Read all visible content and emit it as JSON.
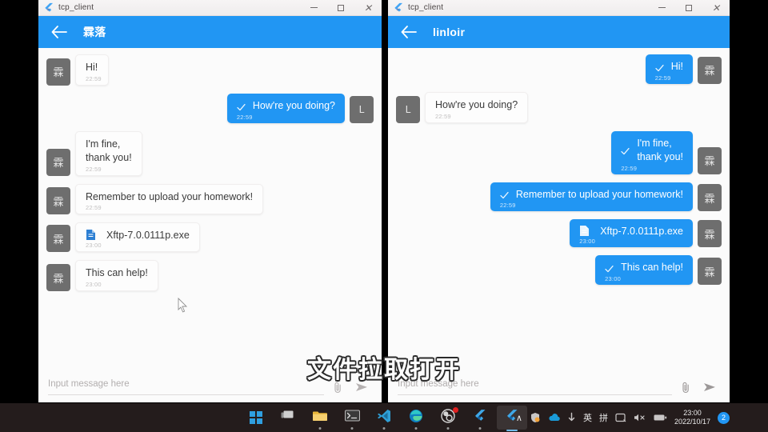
{
  "windows": [
    {
      "titlebar": {
        "app_title": "tcp_client",
        "icon": "flutter-logo-icon",
        "minimize": "–",
        "maximize": "□",
        "close": "×"
      },
      "appbar": {
        "back_icon": "arrow-left-icon",
        "title": "霖落"
      },
      "input": {
        "placeholder": "Input message here",
        "value": "",
        "attach_icon": "paperclip-icon",
        "send_icon": "send-arrow-icon"
      },
      "messages": [
        {
          "side": "in",
          "avatar": "霖",
          "text": "Hi!",
          "time": "22:59",
          "type": "text",
          "checked": false
        },
        {
          "side": "out",
          "avatar": "L",
          "text": "How're you doing?",
          "time": "22:59",
          "type": "text",
          "checked": true
        },
        {
          "side": "in",
          "avatar": "霖",
          "text": "I'm fine,\nthank you!",
          "time": "22:59",
          "type": "text",
          "checked": false
        },
        {
          "side": "in",
          "avatar": "霖",
          "text": "Remember to upload your homework!",
          "time": "22:59",
          "type": "text",
          "checked": false
        },
        {
          "side": "in",
          "avatar": "霖",
          "text": "Xftp-7.0.0111p.exe",
          "time": "23:00",
          "type": "file",
          "checked": false
        },
        {
          "side": "in",
          "avatar": "霖",
          "text": "This can help!",
          "time": "23:00",
          "type": "text",
          "checked": false
        }
      ]
    },
    {
      "titlebar": {
        "app_title": "tcp_client",
        "icon": "flutter-logo-icon",
        "minimize": "–",
        "maximize": "□",
        "close": "×"
      },
      "appbar": {
        "back_icon": "arrow-left-icon",
        "title": "linloir"
      },
      "input": {
        "placeholder": "Input message here",
        "value": "",
        "attach_icon": "paperclip-icon",
        "send_icon": "send-arrow-icon"
      },
      "messages": [
        {
          "side": "out",
          "avatar": "霖",
          "text": "Hi!",
          "time": "22:59",
          "type": "text",
          "checked": true
        },
        {
          "side": "in",
          "avatar": "L",
          "text": "How're you doing?",
          "time": "22:59",
          "type": "text",
          "checked": false
        },
        {
          "side": "out",
          "avatar": "霖",
          "text": "I'm fine,\nthank you!",
          "time": "22:59",
          "type": "text",
          "checked": true
        },
        {
          "side": "out",
          "avatar": "霖",
          "text": "Remember to upload your homework!",
          "time": "22:59",
          "type": "text",
          "checked": true
        },
        {
          "side": "out",
          "avatar": "霖",
          "text": "Xftp-7.0.0111p.exe",
          "time": "23:00",
          "type": "file",
          "checked": false
        },
        {
          "side": "out",
          "avatar": "霖",
          "text": "This can help!",
          "time": "23:00",
          "type": "text",
          "checked": true
        }
      ]
    }
  ],
  "subtitle": {
    "text": "文件拉取打开"
  },
  "taskbar": {
    "apps": [
      {
        "name": "start-button",
        "icon": "windows-logo-icon",
        "state": "none"
      },
      {
        "name": "task-view-button",
        "icon": "task-view-icon",
        "state": "none"
      },
      {
        "name": "file-explorer-button",
        "icon": "folder-icon",
        "state": "running"
      },
      {
        "name": "terminal-button",
        "icon": "terminal-icon",
        "state": "running"
      },
      {
        "name": "vscode-button",
        "icon": "vscode-icon",
        "state": "running"
      },
      {
        "name": "edge-button",
        "icon": "edge-icon",
        "state": "running"
      },
      {
        "name": "obs-button",
        "icon": "obs-icon",
        "state": "running",
        "badge": true
      },
      {
        "name": "flutter-app-1-button",
        "icon": "flutter-logo-icon",
        "state": "running"
      },
      {
        "name": "flutter-app-2-button",
        "icon": "flutter-logo-icon",
        "state": "active"
      }
    ],
    "tray": {
      "overflow": "∧",
      "items": [
        {
          "name": "security-icon",
          "glyph": "⛉"
        },
        {
          "name": "onedrive-icon",
          "glyph": "☁"
        },
        {
          "name": "usb-eject-icon",
          "glyph": "⚲"
        },
        {
          "name": "ime-mode-label",
          "glyph": "英"
        },
        {
          "name": "ime-pinyin-label",
          "glyph": "拼"
        },
        {
          "name": "ime-tool-icon",
          "glyph": "⌨"
        },
        {
          "name": "volume-mute-icon",
          "glyph": "⧸"
        },
        {
          "name": "battery-icon",
          "glyph": "▬"
        }
      ],
      "clock_time": "23:00",
      "clock_date": "2022/10/17",
      "notification_count": "2"
    }
  },
  "colors": {
    "accent": "#2196f3",
    "avatar": "#6e6e6e",
    "taskbar": "#241c1c",
    "window_bg": "#fbfbfb"
  }
}
